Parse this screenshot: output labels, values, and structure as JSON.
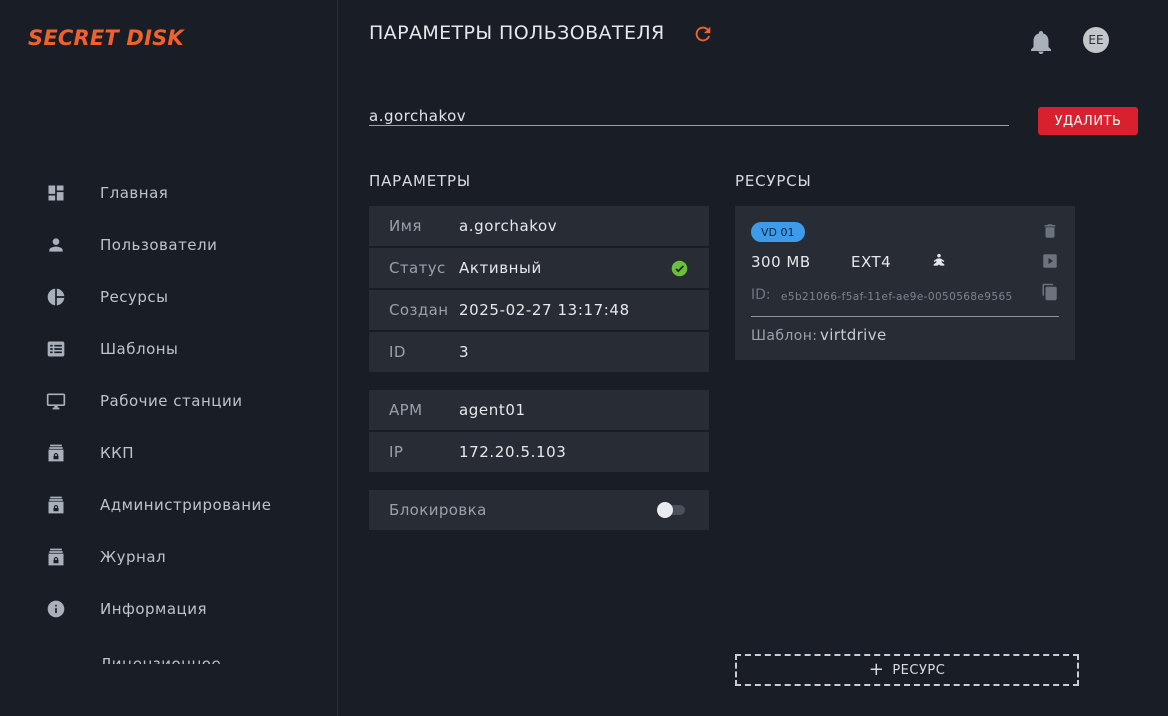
{
  "app": {
    "logo": "SECRET DISK"
  },
  "sidebar": {
    "items": [
      {
        "label": "Главная",
        "icon": "dashboard-icon"
      },
      {
        "label": "Пользователи",
        "icon": "user-icon"
      },
      {
        "label": "Ресурсы",
        "icon": "pie-chart-icon"
      },
      {
        "label": "Шаблоны",
        "icon": "template-icon"
      },
      {
        "label": "Рабочие станции",
        "icon": "monitor-icon"
      },
      {
        "label": "ККП",
        "icon": "locked-box-icon"
      },
      {
        "label": "Администрирование",
        "icon": "locked-box-icon"
      },
      {
        "label": "Журнал",
        "icon": "locked-box-icon"
      },
      {
        "label": "Информация",
        "icon": "info-icon"
      },
      {
        "label": "Лицензионное",
        "icon": ""
      }
    ]
  },
  "header": {
    "title": "ПАРАМЕТРЫ ПОЛЬЗОВАТЕЛЯ",
    "avatar_initials": "EE"
  },
  "user": {
    "login": "a.gorchakov",
    "delete_label": "УДАЛИТЬ"
  },
  "params": {
    "heading": "ПАРАМЕТРЫ",
    "name_label": "Имя",
    "name_value": "a.gorchakov",
    "status_label": "Статус",
    "status_value": "Активный",
    "created_label": "Создан",
    "created_value": "2025-02-27 13:17:48",
    "id_label": "ID",
    "id_value": "3",
    "arm_label": "АРМ",
    "arm_value": "agent01",
    "ip_label": "IP",
    "ip_value": "172.20.5.103",
    "block_label": "Блокировка",
    "block_enabled": false
  },
  "resources": {
    "heading": "РЕСУРСЫ",
    "items": [
      {
        "badge": "VD 01",
        "size": "300 MB",
        "fs": "EXT4",
        "id_label": "ID:",
        "id_value": "e5b21066-f5af-11ef-ae9e-0050568e9565",
        "template_label": "Шаблон:",
        "template_value": "virtdrive"
      }
    ],
    "add_label": "РЕСУРС"
  },
  "colors": {
    "accent": "#f0622d",
    "danger": "#d9202f",
    "badge": "#3d9be9",
    "success": "#6bbf3a"
  }
}
